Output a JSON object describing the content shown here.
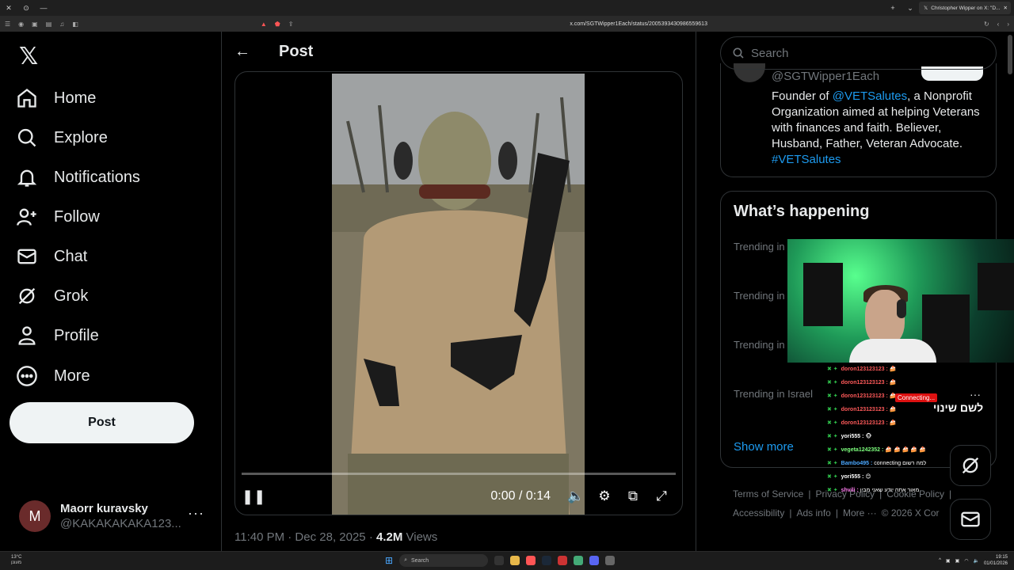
{
  "browser": {
    "tab_title": "Christopher Wipper on X: \"D...",
    "url": "x.com/SGTWipper1Each/status/2005393430986559613"
  },
  "nav": {
    "items": [
      {
        "label": "Home",
        "icon": "home-icon"
      },
      {
        "label": "Explore",
        "icon": "search-icon"
      },
      {
        "label": "Notifications",
        "icon": "bell-icon"
      },
      {
        "label": "Follow",
        "icon": "follow-icon"
      },
      {
        "label": "Chat",
        "icon": "mail-icon"
      },
      {
        "label": "Grok",
        "icon": "grok-icon"
      },
      {
        "label": "Profile",
        "icon": "person-icon"
      },
      {
        "label": "More",
        "icon": "more-circle-icon"
      }
    ],
    "post_label": "Post"
  },
  "account": {
    "avatar_letter": "M",
    "name": "Maorr kuravsky",
    "handle": "@KAKAKAKAKA123..."
  },
  "header": {
    "title": "Post"
  },
  "video": {
    "time": "0:00 / 0:14",
    "progress": 0.0
  },
  "post_meta": {
    "time": "11:40 PM · Dec 28, 2025 · ",
    "views_count": "4.2M",
    "views_label": " Views"
  },
  "search": {
    "placeholder": "Search"
  },
  "bio": {
    "handle": "@SGTWipper1Each",
    "text_1": "Founder of ",
    "link_1": "@VETSalutes",
    "text_2": ", a Nonprofit Organization aimed at helping Veterans with finances and faith. Believer, Husband, Father, Veteran Advocate. ",
    "link_2": "#VETSalutes"
  },
  "happening": {
    "title": "What’s happening",
    "trends": [
      "Trending in",
      "Trending in",
      "Trending in",
      "Trending in Israel"
    ],
    "show_more": "Show more"
  },
  "footer": {
    "links": [
      "Terms of Service",
      "|",
      "Privacy Policy",
      "|",
      "Cookie Policy",
      "|",
      "Accessibility",
      "|",
      "Ads info",
      "|",
      "More ···",
      "© 2026 X Cor"
    ]
  },
  "stream": {
    "connecting": "Connecting...",
    "heb_text": "לשם שינוי",
    "chat": [
      {
        "user": "doron123123123 :",
        "msg": "🍰",
        "style": "user"
      },
      {
        "user": "doron123123123 :",
        "msg": "🍰",
        "style": "user"
      },
      {
        "user": "doron123123123 :",
        "msg": "🍰",
        "style": "user"
      },
      {
        "user": "doron123123123 :",
        "msg": "🍰",
        "style": "user"
      },
      {
        "user": "doron123123123 :",
        "msg": "🍰",
        "style": "user"
      },
      {
        "user": "yori555 :",
        "msg": "🐵",
        "style": "user2"
      },
      {
        "user": "vegeta1242352 :",
        "msg": "🍰 🍰 🍰 🍰 🍰",
        "style": "user2"
      },
      {
        "user": "Bambo495 :",
        "msg": "connecting למה רשום",
        "style": "user3"
      },
      {
        "user": "yori555 :",
        "msg": "😊",
        "style": "user2"
      },
      {
        "user": "shvili :",
        "msg": "מאור אתה יודע שאני מבין",
        "style": "user2"
      }
    ]
  },
  "taskbar": {
    "weather_temp": "13°C",
    "weather_desc": "מעונן",
    "search_label": "Search",
    "time": "19:15",
    "date": "01/01/2026"
  },
  "colors": {
    "accent": "#1d9bf0",
    "bg": "#000000",
    "border": "#2f3336"
  }
}
